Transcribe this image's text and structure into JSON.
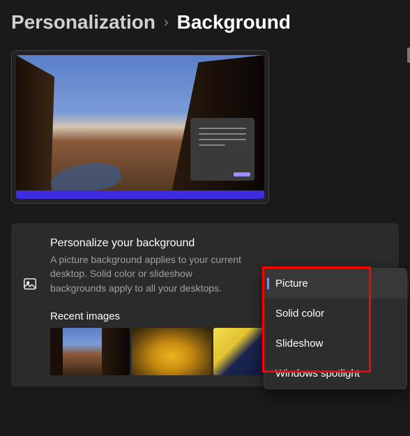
{
  "breadcrumb": {
    "parent": "Personalization",
    "separator": "›",
    "current": "Background"
  },
  "personalize": {
    "title": "Personalize your background",
    "description": "A picture background applies to your current desktop. Solid color or slideshow backgrounds apply to all your desktops."
  },
  "recent": {
    "title": "Recent images"
  },
  "dropdown": {
    "options": [
      {
        "label": "Picture",
        "selected": true
      },
      {
        "label": "Solid color",
        "selected": false
      },
      {
        "label": "Slideshow",
        "selected": false
      },
      {
        "label": "Windows spotlight",
        "selected": false
      }
    ]
  }
}
